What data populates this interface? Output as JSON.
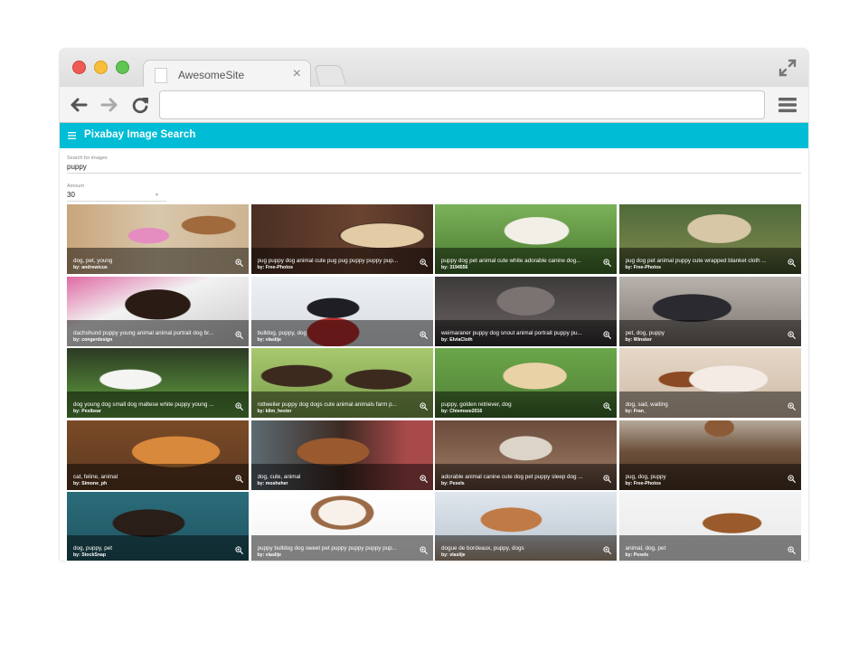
{
  "browser": {
    "tab_title": "AwesomeSite",
    "tab_close": "×",
    "url": ""
  },
  "app": {
    "title": "Pixabay Image Search",
    "accent_color": "#00bcd4",
    "search": {
      "label": "Search for images",
      "value": "puppy"
    },
    "amount": {
      "label": "Amount",
      "value": "30"
    },
    "images": [
      {
        "tags": "dog, pet, young",
        "author": "andrewicus"
      },
      {
        "tags": "pug puppy dog animal cute pug pug puppy puppy pup...",
        "author": "Free-Photos"
      },
      {
        "tags": "puppy dog pet animal cute white adorable canine dog...",
        "author": "3194556"
      },
      {
        "tags": "pug dog pet animal puppy cute wrapped blanket cloth ...",
        "author": "Free-Photos"
      },
      {
        "tags": "dachshund puppy young animal animal portrait dog br...",
        "author": "congerdesign"
      },
      {
        "tags": "bulldog, puppy, dog",
        "author": "vlaslije"
      },
      {
        "tags": "weimaraner puppy dog snout animal portrait puppy pu...",
        "author": "ElviaCloth"
      },
      {
        "tags": "pet, dog, puppy",
        "author": "Winsker"
      },
      {
        "tags": "dog young dog small dog maltese white puppy young ...",
        "author": "Pexibear"
      },
      {
        "tags": "rottweiler puppy dog dogs cute animal animals farm p...",
        "author": "klim_hester"
      },
      {
        "tags": "puppy, golden retriever, dog",
        "author": "Chiemsee2016"
      },
      {
        "tags": "dog, sad, waiting",
        "author": "Fran_"
      },
      {
        "tags": "cat, feline, animal",
        "author": "Simone_ph"
      },
      {
        "tags": "dog, cute, animal",
        "author": "mosheher"
      },
      {
        "tags": "adorable animal canine cute dog pet puppy sleep dog ...",
        "author": "Pexels"
      },
      {
        "tags": "pug, dog, puppy",
        "author": "Free-Photos"
      },
      {
        "tags": "dog, puppy, pet",
        "author": "StockSnap"
      },
      {
        "tags": "puppy bulldog dog sweet pet puppy puppy puppy pup...",
        "author": "vlaslije"
      },
      {
        "tags": "dogue de bordeaux, puppy, dogs",
        "author": "vlaslije"
      },
      {
        "tags": "animal, dog, pet",
        "author": "Pexels"
      }
    ],
    "author_prefix": "by: "
  },
  "icons": {
    "back": "arrow-left-icon",
    "forward": "arrow-right-icon",
    "reload": "reload-icon",
    "menu": "hamburger-menu-icon",
    "fullscreen": "fullscreen-icon",
    "zoom": "zoom-in-icon"
  }
}
